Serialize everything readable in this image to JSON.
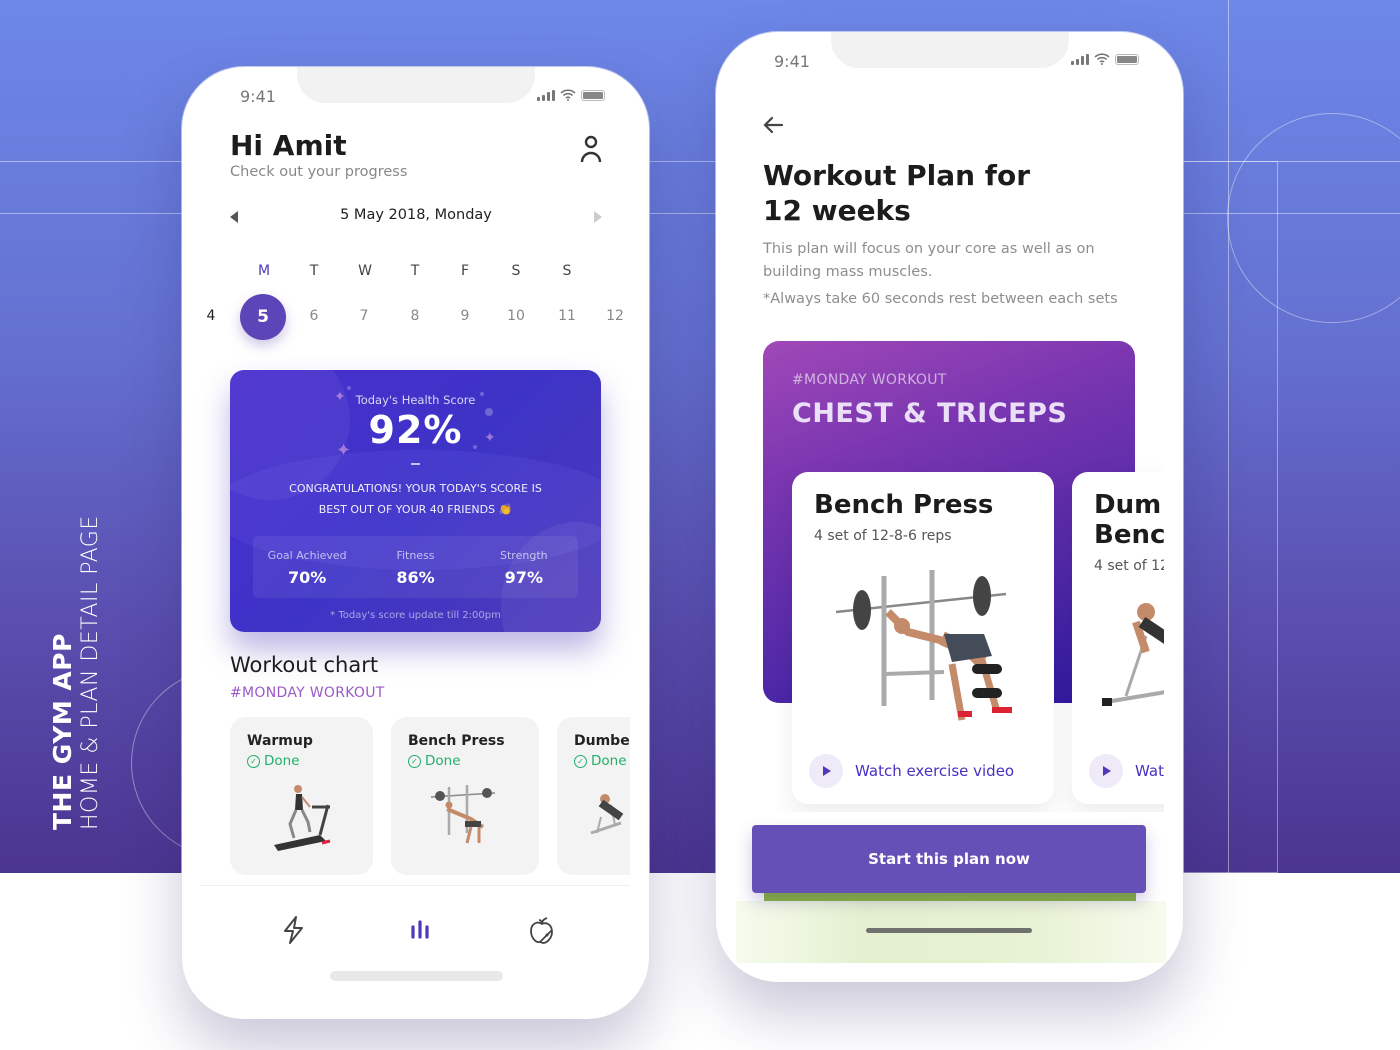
{
  "presentation": {
    "title": "THE GYM APP",
    "subtitle": "HOME & PLAN DETAIL PAGE"
  },
  "home_screen": {
    "status_bar": {
      "time": "9:41"
    },
    "greeting": "Hi Amit",
    "subtitle": "Check out your progress",
    "date_label": "5 May 2018, Monday",
    "weekdays": [
      "M",
      "T",
      "W",
      "T",
      "F",
      "S",
      "S"
    ],
    "days": [
      "4",
      "5",
      "6",
      "7",
      "8",
      "9",
      "10",
      "11",
      "12"
    ],
    "selected_day": "5",
    "health_card": {
      "title": "Today's Health Score",
      "score": "92%",
      "message_line1": "CONGRATULATIONS! YOUR TODAY'S SCORE IS",
      "message_line2": "BEST OUT OF YOUR 40 FRIENDS 👏",
      "stats": [
        {
          "label": "Goal Achieved",
          "value": "70%"
        },
        {
          "label": "Fitness",
          "value": "86%"
        },
        {
          "label": "Strength",
          "value": "97%"
        }
      ],
      "note": "* Today's score update till 2:00pm"
    },
    "workout_chart": {
      "title": "Workout chart",
      "tag": "#MONDAY WORKOUT",
      "cards": [
        {
          "name": "Warmup",
          "status": "Done"
        },
        {
          "name": "Bench Press",
          "status": "Done"
        },
        {
          "name": "Dumbe",
          "status": "Done"
        }
      ]
    },
    "tab_bar": {
      "items": [
        "activity-icon",
        "stats-icon",
        "nutrition-icon"
      ],
      "active": "stats-icon"
    }
  },
  "plan_screen": {
    "status_bar": {
      "time": "9:41"
    },
    "title_line1": "Workout Plan for",
    "title_line2": "12 weeks",
    "description": "This plan will focus on your core as well as on building mass muscles.",
    "note": "*Always take 60 seconds rest between each sets",
    "plan_tag": "#MONDAY WORKOUT",
    "plan_name": "CHEST & TRICEPS",
    "exercises": [
      {
        "name": "Bench Press",
        "detail": "4 set of 12-8-6 reps",
        "action": "Watch exercise video"
      },
      {
        "name": "Dumbbell Bench",
        "name_line1": "Dum",
        "name_line2": "Benc",
        "detail": "4 set of 12",
        "action": "Wat"
      }
    ],
    "start_button": "Start this plan now"
  },
  "colors": {
    "accent": "#5c45b8",
    "done_green": "#22b06a",
    "tag_purple": "#9b59c8"
  }
}
